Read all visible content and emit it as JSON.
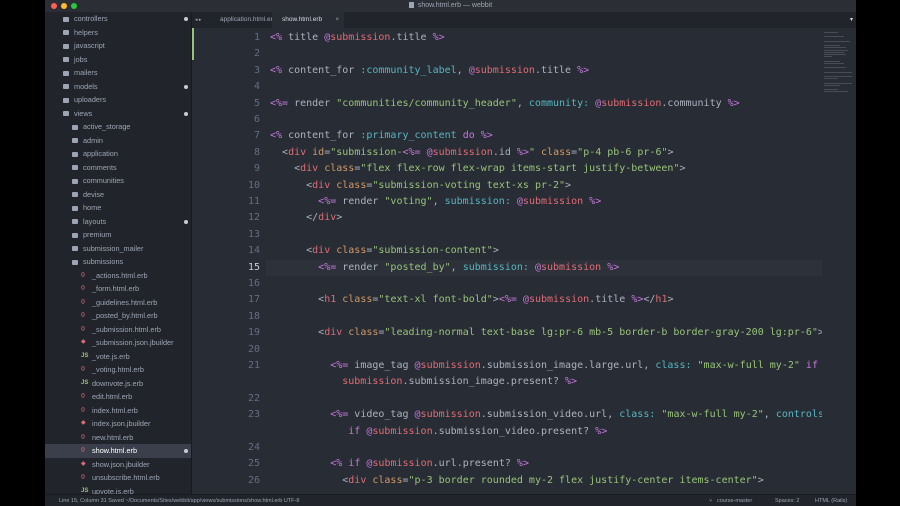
{
  "window": {
    "title": "show.html.erb — webbit"
  },
  "tabs": [
    {
      "label": "application.html.erb",
      "active": false
    },
    {
      "label": "show.html.erb",
      "active": true
    }
  ],
  "tabs_close": "×",
  "tree": [
    {
      "label": "controllers",
      "kind": "folder",
      "depth": 1,
      "modified": true
    },
    {
      "label": "helpers",
      "kind": "folder",
      "depth": 1,
      "modified": false
    },
    {
      "label": "javascript",
      "kind": "folder",
      "depth": 1,
      "modified": false
    },
    {
      "label": "jobs",
      "kind": "folder",
      "depth": 1,
      "modified": false
    },
    {
      "label": "mailers",
      "kind": "folder",
      "depth": 1,
      "modified": false
    },
    {
      "label": "models",
      "kind": "folder",
      "depth": 1,
      "modified": true
    },
    {
      "label": "uploaders",
      "kind": "folder",
      "depth": 1,
      "modified": false
    },
    {
      "label": "views",
      "kind": "folder",
      "depth": 1,
      "modified": true
    },
    {
      "label": "active_storage",
      "kind": "folder",
      "depth": 2,
      "modified": false
    },
    {
      "label": "admin",
      "kind": "folder",
      "depth": 2,
      "modified": false
    },
    {
      "label": "application",
      "kind": "folder",
      "depth": 2,
      "modified": false
    },
    {
      "label": "comments",
      "kind": "folder",
      "depth": 2,
      "modified": false
    },
    {
      "label": "communities",
      "kind": "folder",
      "depth": 2,
      "modified": false
    },
    {
      "label": "devise",
      "kind": "folder",
      "depth": 2,
      "modified": false
    },
    {
      "label": "home",
      "kind": "folder",
      "depth": 2,
      "modified": false
    },
    {
      "label": "layouts",
      "kind": "folder",
      "depth": 2,
      "modified": true
    },
    {
      "label": "premium",
      "kind": "folder",
      "depth": 2,
      "modified": false
    },
    {
      "label": "submission_mailer",
      "kind": "folder",
      "depth": 2,
      "modified": false
    },
    {
      "label": "submissions",
      "kind": "folder",
      "depth": 2,
      "modified": false
    },
    {
      "label": "_actions.html.erb",
      "kind": "erb",
      "depth": 3,
      "modified": false
    },
    {
      "label": "_form.html.erb",
      "kind": "erb",
      "depth": 3,
      "modified": false
    },
    {
      "label": "_guidelines.html.erb",
      "kind": "erb",
      "depth": 3,
      "modified": false
    },
    {
      "label": "_posted_by.html.erb",
      "kind": "erb",
      "depth": 3,
      "modified": false
    },
    {
      "label": "_submission.html.erb",
      "kind": "erb",
      "depth": 3,
      "modified": false
    },
    {
      "label": "_submission.json.jbuilder",
      "kind": "ruby",
      "depth": 3,
      "modified": false
    },
    {
      "label": "_vote.js.erb",
      "kind": "js",
      "depth": 3,
      "modified": false
    },
    {
      "label": "_voting.html.erb",
      "kind": "erb",
      "depth": 3,
      "modified": false
    },
    {
      "label": "downvote.js.erb",
      "kind": "js",
      "depth": 3,
      "modified": false
    },
    {
      "label": "edit.html.erb",
      "kind": "erb",
      "depth": 3,
      "modified": false
    },
    {
      "label": "index.html.erb",
      "kind": "erb",
      "depth": 3,
      "modified": false
    },
    {
      "label": "index.json.jbuilder",
      "kind": "ruby",
      "depth": 3,
      "modified": false
    },
    {
      "label": "new.html.erb",
      "kind": "erb",
      "depth": 3,
      "modified": false
    },
    {
      "label": "show.html.erb",
      "kind": "erb",
      "depth": 3,
      "modified": true,
      "selected": true
    },
    {
      "label": "show.json.jbuilder",
      "kind": "ruby",
      "depth": 3,
      "modified": false
    },
    {
      "label": "unsubscribe.html.erb",
      "kind": "erb",
      "depth": 3,
      "modified": false
    },
    {
      "label": "upvote.js.erb",
      "kind": "js",
      "depth": 3,
      "modified": false
    }
  ],
  "editor": {
    "current_line": 15,
    "lines": [
      {
        "n": "1",
        "html": "<span class='k'>&lt;%</span> title <span class='k'>@</span><span class='i'>submission</span>.title <span class='k'>%&gt;</span>"
      },
      {
        "n": "2",
        "html": ""
      },
      {
        "n": "3",
        "html": "<span class='k'>&lt;%</span> content_for <span class='c'>:community_label</span>, <span class='k'>@</span><span class='i'>submission</span>.title <span class='k'>%&gt;</span>"
      },
      {
        "n": "4",
        "html": ""
      },
      {
        "n": "5",
        "html": "<span class='k'>&lt;%=</span> render <span class='s'>\"communities/community_header\"</span>, <span class='c'>community:</span> <span class='k'>@</span><span class='i'>submission</span>.community <span class='k'>%&gt;</span>"
      },
      {
        "n": "6",
        "html": ""
      },
      {
        "n": "7",
        "html": "<span class='k'>&lt;%</span> content_for <span class='c'>:primary_content</span> <span class='k'>do</span> <span class='k'>%&gt;</span>"
      },
      {
        "n": "8",
        "html": "  &lt;<span class='i'>div</span> <span class='n'>id</span>=<span class='s'>\"submission-</span><span class='k'>&lt;%=</span> <span class='k'>@</span><span class='i'>submission</span>.id <span class='k'>%&gt;</span><span class='s'>\"</span> <span class='n'>class</span>=<span class='s'>\"p-4 pb-6 pr-6\"</span>&gt;"
      },
      {
        "n": "9",
        "html": "    &lt;<span class='i'>div</span> <span class='n'>class</span>=<span class='s'>\"flex flex-row flex-wrap items-start justify-between\"</span>&gt;"
      },
      {
        "n": "10",
        "html": "      &lt;<span class='i'>div</span> <span class='n'>class</span>=<span class='s'>\"submission-voting text-xs pr-2\"</span>&gt;"
      },
      {
        "n": "11",
        "html": "        <span class='k'>&lt;%=</span> render <span class='s'>\"voting\"</span>, <span class='c'>submission:</span> <span class='k'>@</span><span class='i'>submission</span> <span class='k'>%&gt;</span>"
      },
      {
        "n": "12",
        "html": "      &lt;/<span class='i'>div</span>&gt;"
      },
      {
        "n": "13",
        "html": ""
      },
      {
        "n": "14",
        "html": "      &lt;<span class='i'>div</span> <span class='n'>class</span>=<span class='s'>\"submission-content\"</span>&gt;"
      },
      {
        "n": "15",
        "html": "        <span class='k'>&lt;%=</span> render <span class='s'>\"posted_by\"</span>, <span class='c'>submission:</span> <span class='k'>@</span><span class='i'>submission</span> <span class='k'>%&gt;</span>"
      },
      {
        "n": "16",
        "html": ""
      },
      {
        "n": "17",
        "html": "        &lt;<span class='i'>h1</span> <span class='n'>class</span>=<span class='s'>\"text-xl font-bold\"</span>&gt;<span class='k'>&lt;%=</span> <span class='k'>@</span><span class='i'>submission</span>.title <span class='k'>%&gt;</span>&lt;/<span class='i'>h1</span>&gt;"
      },
      {
        "n": "18",
        "html": ""
      },
      {
        "n": "19",
        "html": "        &lt;<span class='i'>div</span> <span class='n'>class</span>=<span class='s'>\"leading-normal text-base lg:pr-6 mb-5 border-b border-gray-200 lg:pr-6\"</span>&gt;"
      },
      {
        "n": "20",
        "html": ""
      },
      {
        "n": "21",
        "html": "          <span class='k'>&lt;%=</span> image_tag <span class='k'>@</span><span class='i'>submission</span>.submission_image.large.url, <span class='c'>class:</span> <span class='s'>\"max-w-full my-2\"</span> <span class='k'>if</span> <span class='k'>@</span>\n            <span class='i'>submission</span>.submission_image.present? <span class='k'>%&gt;</span>"
      },
      {
        "n": "22",
        "html": ""
      },
      {
        "n": "23",
        "html": "          <span class='k'>&lt;%=</span> video_tag <span class='k'>@</span><span class='i'>submission</span>.submission_video.url, <span class='c'>class:</span> <span class='s'>\"max-w-full my-2\"</span>, <span class='c'>controls:</span> <span class='n'>true</span>\n             <span class='k'>if</span> <span class='k'>@</span><span class='i'>submission</span>.submission_video.present? <span class='k'>%&gt;</span>"
      },
      {
        "n": "24",
        "html": ""
      },
      {
        "n": "25",
        "html": "          <span class='k'>&lt;%</span> <span class='k'>if</span> <span class='k'>@</span><span class='i'>submission</span>.url.present? <span class='k'>%&gt;</span>"
      },
      {
        "n": "26",
        "html": "            &lt;<span class='i'>div</span> <span class='n'>class</span>=<span class='s'>\"p-3 border rounded my-2 flex justify-center items-center\"</span>&gt;"
      }
    ]
  },
  "status": {
    "left": "Line 15, Column 31  Saved  ~/Documents/Sites/webbit/app/views/submissions/show.html.erb  UTF-8",
    "branch": "course-master",
    "spaces": "Spaces: 2",
    "grammar": "HTML (Rails)"
  },
  "colors": {
    "tree_bg": "#21252b",
    "editor_bg": "#282c34",
    "keyword": "#c678dd",
    "string": "#98c379",
    "ivar": "#e06c75",
    "symbol": "#56b6c2"
  }
}
